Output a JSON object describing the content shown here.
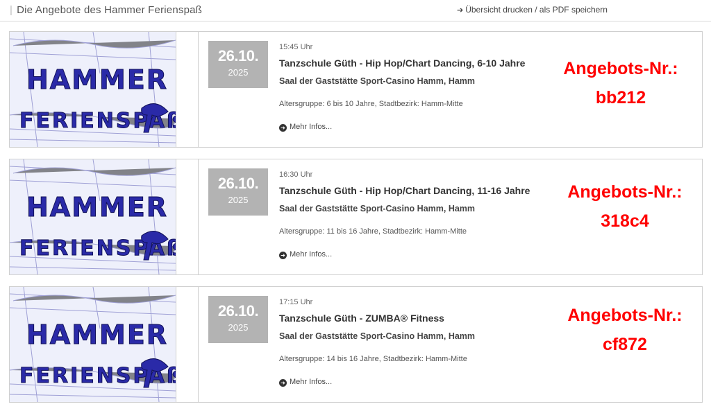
{
  "header": {
    "title": "Die Angebote des Hammer Ferienspaß",
    "print_link": "Übersicht drucken / als PDF speichern"
  },
  "offers": [
    {
      "date": "26.10.",
      "year": "2025",
      "time": "15:45 Uhr",
      "title": "Tanzschule Güth - Hip Hop/Chart Dancing, 6-10 Jahre",
      "venue": "Saal der Gaststätte Sport-Casino Hamm, Hamm",
      "ages": "Altersgruppe: 6 bis 10 Jahre, Stadtbezirk: Hamm-Mitte",
      "more": "Mehr Infos...",
      "offer_label": "Angebots-Nr.:",
      "offer_code": "bb212"
    },
    {
      "date": "26.10.",
      "year": "2025",
      "time": "16:30 Uhr",
      "title": "Tanzschule Güth - Hip Hop/Chart Dancing, 11-16 Jahre",
      "venue": "Saal der Gaststätte Sport-Casino Hamm, Hamm",
      "ages": "Altersgruppe: 11 bis 16 Jahre, Stadtbezirk: Hamm-Mitte",
      "more": "Mehr Infos...",
      "offer_label": "Angebots-Nr.:",
      "offer_code": "318c4"
    },
    {
      "date": "26.10.",
      "year": "2025",
      "time": "17:15 Uhr",
      "title": "Tanzschule Güth - ZUMBA® Fitness",
      "venue": "Saal der Gaststätte Sport-Casino Hamm, Hamm",
      "ages": "Altersgruppe: 14 bis 16 Jahre, Stadtbezirk: Hamm-Mitte",
      "more": "Mehr Infos...",
      "offer_label": "Angebots-Nr.:",
      "offer_code": "cf872"
    }
  ],
  "logo": {
    "line1": "HAMMER",
    "line2": "FERIENSPAß"
  },
  "colors": {
    "accent_red": "#ff0000",
    "date_box": "#b3b3b3",
    "logo_blue": "#2a2aa8"
  }
}
